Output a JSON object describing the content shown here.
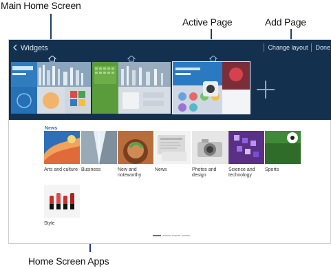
{
  "callouts": {
    "main_home_screen": "Main Home Screen",
    "active_page": "Active Page",
    "add_page": "Add Page",
    "home_screen_apps": "Home Screen Apps"
  },
  "header": {
    "back_icon": "chevron-left-icon",
    "title": "Widgets",
    "change_layout": "Change layout",
    "done": "Done"
  },
  "home_pages": {
    "home_icon": "home-icon",
    "page_count": 3,
    "active_index": 2,
    "add_icon": "plus-icon"
  },
  "apps": {
    "section_title": "News",
    "items": [
      {
        "label": "Arts and culture"
      },
      {
        "label": "Business"
      },
      {
        "label": "New and noteworthy"
      },
      {
        "label": "News"
      },
      {
        "label": "Photos and design"
      },
      {
        "label": "Science and technology"
      },
      {
        "label": "Sports"
      },
      {
        "label": "Style"
      }
    ]
  },
  "pager": {
    "count": 4,
    "active_index": 0
  },
  "colors": {
    "topbar": "#14304f",
    "section_accent": "#2c74b8",
    "callout_line": "#1f3d6b"
  }
}
